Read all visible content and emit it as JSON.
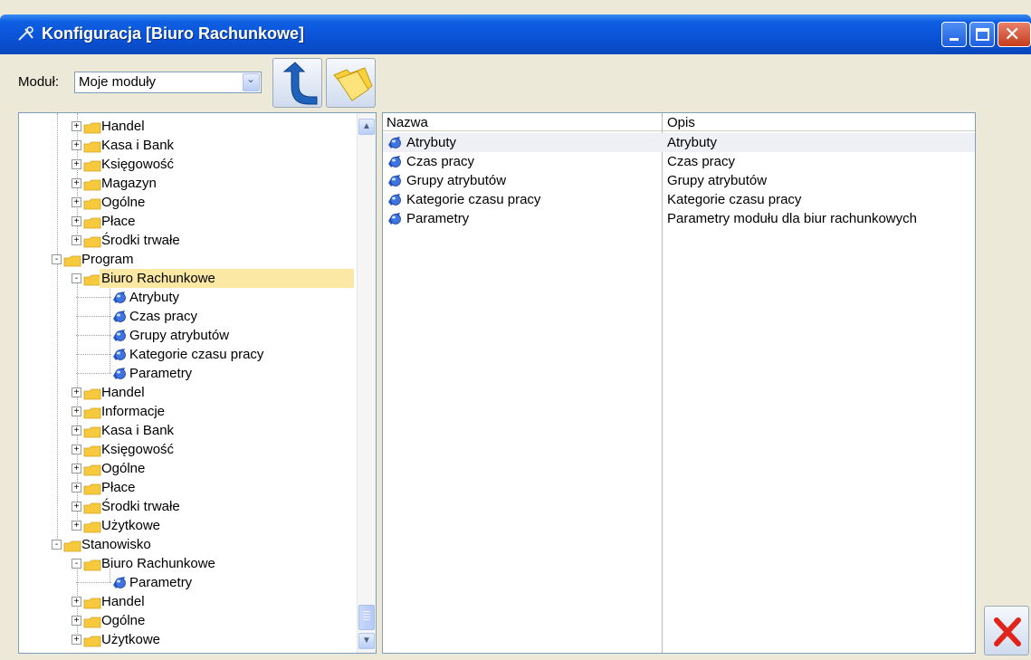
{
  "window": {
    "title": "Konfiguracja [Biuro Rachunkowe]"
  },
  "toolbar": {
    "module_label": "Moduł:",
    "module_value": "Moje moduły"
  },
  "tree": {
    "items": [
      {
        "label": "Handel",
        "type": "folder",
        "level": 2,
        "expander": "+"
      },
      {
        "label": "Kasa i Bank",
        "type": "folder",
        "level": 2,
        "expander": "+"
      },
      {
        "label": "Księgowość",
        "type": "folder",
        "level": 2,
        "expander": "+"
      },
      {
        "label": "Magazyn",
        "type": "folder",
        "level": 2,
        "expander": "+"
      },
      {
        "label": "Ogólne",
        "type": "folder",
        "level": 2,
        "expander": "+"
      },
      {
        "label": "Płace",
        "type": "folder",
        "level": 2,
        "expander": "+"
      },
      {
        "label": "Środki trwałe",
        "type": "folder",
        "level": 2,
        "expander": "+"
      },
      {
        "label": "Program",
        "type": "folder",
        "level": 1,
        "expander": "-"
      },
      {
        "label": "Biuro Rachunkowe",
        "type": "folder",
        "level": 2,
        "expander": "-",
        "selected": true
      },
      {
        "label": "Atrybuty",
        "type": "leaf",
        "level": 3
      },
      {
        "label": "Czas pracy",
        "type": "leaf",
        "level": 3
      },
      {
        "label": "Grupy atrybutów",
        "type": "leaf",
        "level": 3
      },
      {
        "label": "Kategorie czasu pracy",
        "type": "leaf",
        "level": 3
      },
      {
        "label": "Parametry",
        "type": "leaf",
        "level": 3
      },
      {
        "label": "Handel",
        "type": "folder",
        "level": 2,
        "expander": "+"
      },
      {
        "label": "Informacje",
        "type": "folder",
        "level": 2,
        "expander": "+"
      },
      {
        "label": "Kasa i Bank",
        "type": "folder",
        "level": 2,
        "expander": "+"
      },
      {
        "label": "Księgowość",
        "type": "folder",
        "level": 2,
        "expander": "+"
      },
      {
        "label": "Ogólne",
        "type": "folder",
        "level": 2,
        "expander": "+"
      },
      {
        "label": "Płace",
        "type": "folder",
        "level": 2,
        "expander": "+"
      },
      {
        "label": "Środki trwałe",
        "type": "folder",
        "level": 2,
        "expander": "+"
      },
      {
        "label": "Użytkowe",
        "type": "folder",
        "level": 2,
        "expander": "+"
      },
      {
        "label": "Stanowisko",
        "type": "folder",
        "level": 1,
        "expander": "-"
      },
      {
        "label": "Biuro Rachunkowe",
        "type": "folder",
        "level": 2,
        "expander": "-"
      },
      {
        "label": "Parametry",
        "type": "leaf",
        "level": 3
      },
      {
        "label": "Handel",
        "type": "folder",
        "level": 2,
        "expander": "+"
      },
      {
        "label": "Ogólne",
        "type": "folder",
        "level": 2,
        "expander": "+"
      },
      {
        "label": "Użytkowe",
        "type": "folder",
        "level": 2,
        "expander": "+"
      }
    ]
  },
  "list": {
    "columns": [
      "Nazwa",
      "Opis"
    ],
    "rows": [
      {
        "name": "Atrybuty",
        "desc": "Atrybuty",
        "selected": true
      },
      {
        "name": "Czas pracy",
        "desc": "Czas pracy"
      },
      {
        "name": "Grupy atrybutów",
        "desc": "Grupy atrybutów"
      },
      {
        "name": "Kategorie czasu pracy",
        "desc": "Kategorie czasu pracy"
      },
      {
        "name": "Parametry",
        "desc": "Parametry modułu dla biur rachunkowych"
      }
    ]
  },
  "icons": {
    "title": "tools-icon",
    "folder": "folder-icon",
    "leaf": "globe-icon",
    "up": "arrow-up-icon",
    "open_folder": "open-folder-icon",
    "close": "close-icon"
  },
  "colors": {
    "titlebar": "#0a52d6",
    "selection": "#fbe8a4",
    "folder": "#f7c93c",
    "leaf": "#2a5bd0",
    "close_red": "#e0241c"
  }
}
